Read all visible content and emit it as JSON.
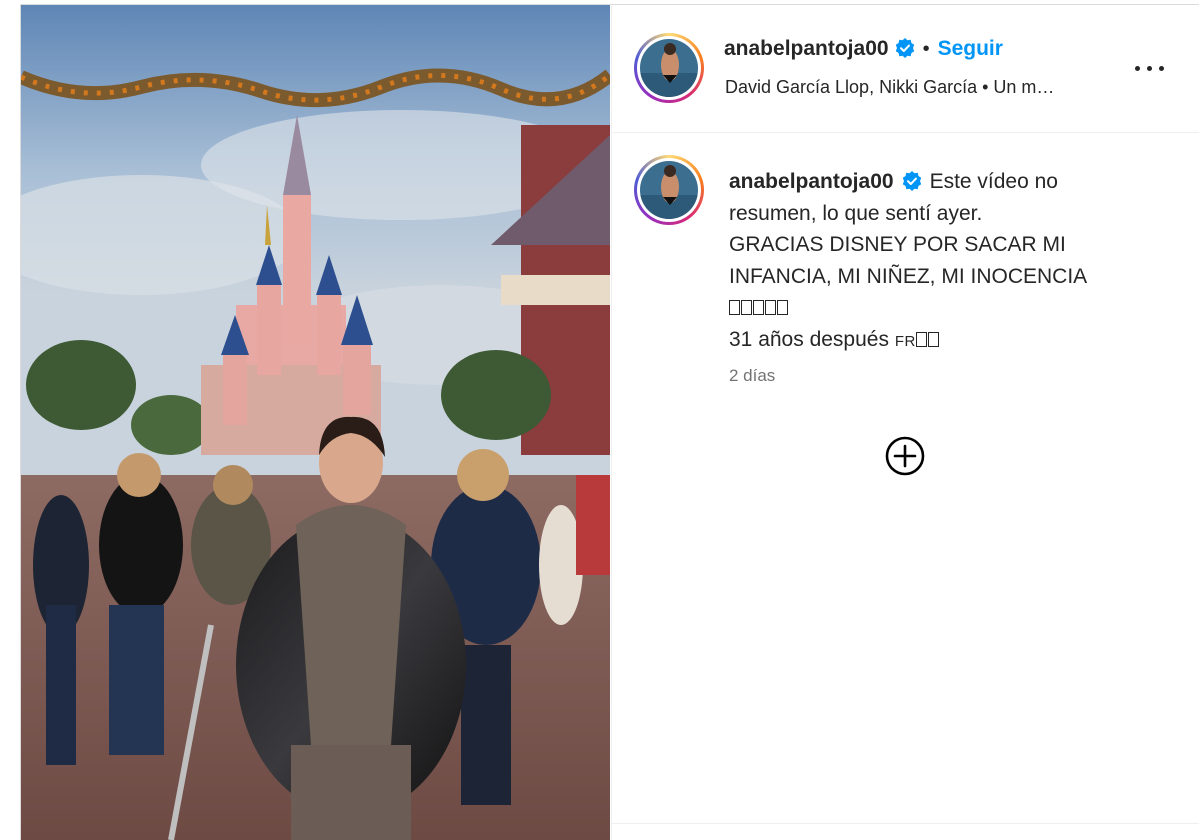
{
  "post": {
    "username": "anabelpantoja00",
    "follow_label": "Seguir",
    "tagged_people": "David García Llop, Nikki García • Un m…",
    "caption_lines": [
      "Este vídeo no",
      "resumen, lo que sentí ayer.",
      "GRACIAS DISNEY POR SACAR MI",
      "INFANCIA, MI NIÑEZ, MI INOCENCIA"
    ],
    "caption_last": "31 años después",
    "flag_text": "FR",
    "time_ago": "2 días"
  },
  "icons": {
    "verified": "verified-badge-icon",
    "more": "more-options-icon",
    "add": "add-comment-circle-icon"
  },
  "colors": {
    "link_blue": "#0095f6",
    "verified_blue": "#0095f6",
    "text": "#262626",
    "muted": "#737373"
  }
}
